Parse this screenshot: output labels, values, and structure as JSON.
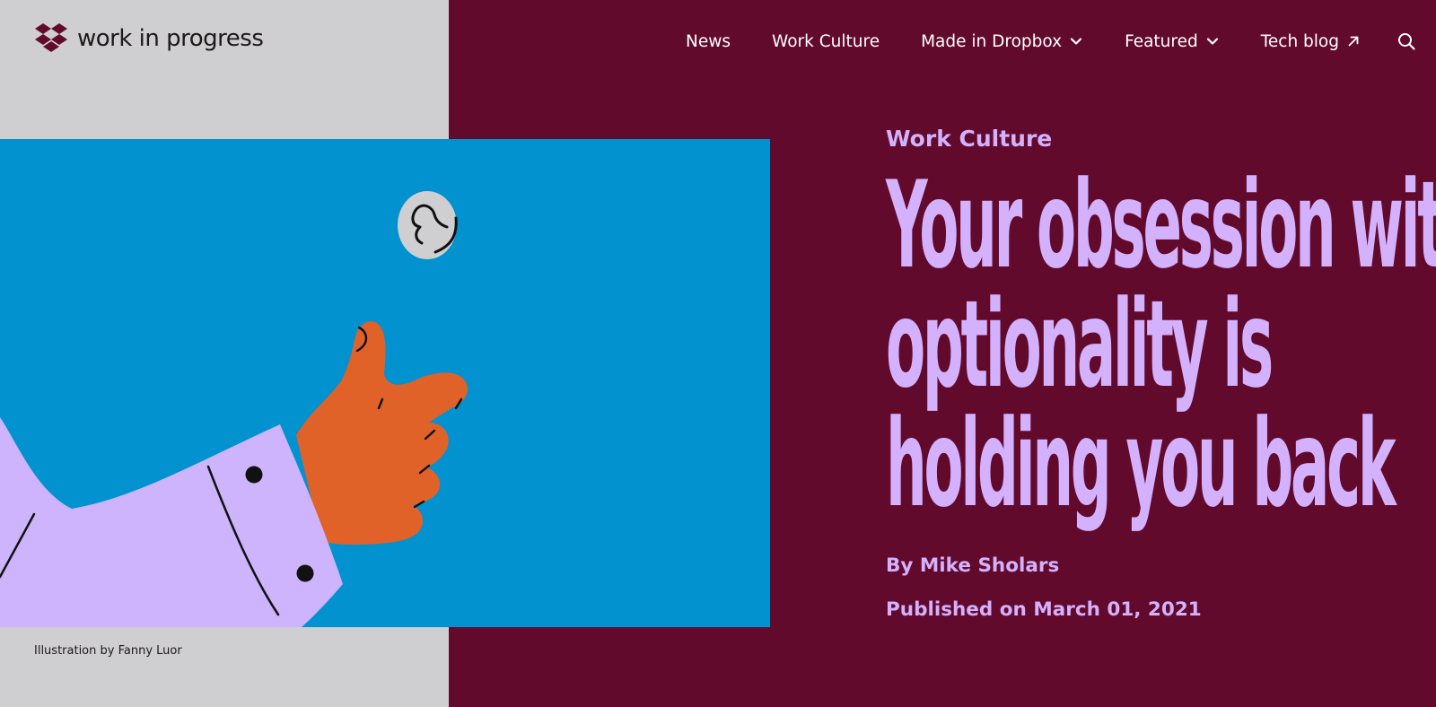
{
  "brand": {
    "name": "work in progress",
    "logo_icon": "dropbox-box-icon",
    "logo_color": "#620a2c"
  },
  "nav": {
    "items": [
      {
        "label": "News",
        "icon": null
      },
      {
        "label": "Work Culture",
        "icon": null
      },
      {
        "label": "Made in Dropbox",
        "icon": "chevron-down-icon"
      },
      {
        "label": "Featured",
        "icon": "chevron-down-icon"
      },
      {
        "label": "Tech blog",
        "icon": "arrow-up-right-icon"
      }
    ],
    "search_icon": "search-icon"
  },
  "hero": {
    "illustration_subject": "hand-flipping-coin",
    "caption": "Illustration by Fanny Luor"
  },
  "article": {
    "category": "Work Culture",
    "title_lines": [
      "Your obsession with",
      "optionality is",
      "holding you back"
    ],
    "author": "By Mike Sholars",
    "published": "Published on March 01, 2021"
  },
  "colors": {
    "left_panel": "#cfced0",
    "right_panel": "#620a2c",
    "illustration_bg": "#0192cf",
    "accent": "#d4b1fd",
    "nav_text": "#ffffff"
  }
}
